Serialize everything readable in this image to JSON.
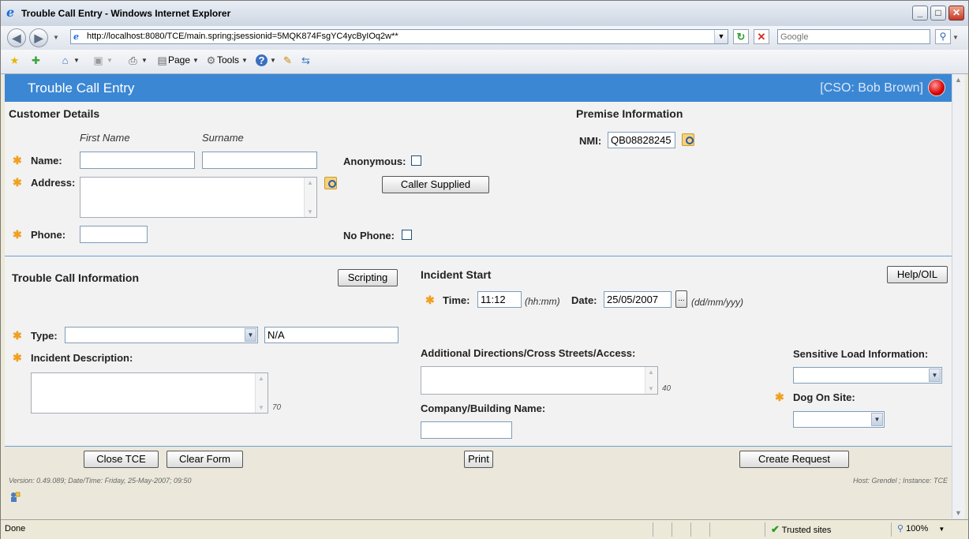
{
  "window": {
    "title": "Trouble Call Entry - Windows Internet Explorer",
    "minimize_glyph": "_",
    "maximize_glyph": "□",
    "close_glyph": "✕"
  },
  "browser": {
    "url": "http://localhost:8080/TCE/main.spring;jsessionid=5MQK874FsgYC4ycByIOq2w**",
    "search_placeholder": "Google",
    "commands": {
      "page": "Page",
      "tools": "Tools"
    },
    "status": "Done",
    "zone": "Trusted sites",
    "zoom": "100%"
  },
  "app": {
    "title": "Trouble Call Entry",
    "user": "[CSO: Bob Brown]"
  },
  "customer": {
    "heading": "Customer Details",
    "first_name_hint": "First Name",
    "surname_hint": "Surname",
    "name_label": "Name:",
    "address_label": "Address:",
    "phone_label": "Phone:",
    "anonymous_label": "Anonymous:",
    "no_phone_label": "No Phone:",
    "caller_supplied_button": "Caller Supplied",
    "first_name": "",
    "surname": "",
    "address": "",
    "phone": ""
  },
  "premise": {
    "heading": "Premise Information",
    "nmi_label": "NMI:",
    "nmi_value": "QB08828245"
  },
  "trouble_call": {
    "heading": "Trouble Call Information",
    "scripting_button": "Scripting",
    "type_label": "Type:",
    "type_value": "",
    "type_code": "N/A",
    "description_label": "Incident Description:",
    "description_limit": "70"
  },
  "incident": {
    "heading": "Incident Start",
    "help_button": "Help/OIL",
    "time_label": "Time:",
    "time_value": "11:12",
    "time_format": "(hh:mm)",
    "date_label": "Date:",
    "date_value": "25/05/2007",
    "date_picker": "...",
    "date_format": "(dd/mm/yyy)",
    "directions_label": "Additional Directions/Cross Streets/Access:",
    "directions_limit": "40",
    "company_label": "Company/Building Name:",
    "company_value": ""
  },
  "sensitive": {
    "load_label": "Sensitive Load Information:",
    "load_value": "",
    "dog_label": "Dog On Site:",
    "dog_value": ""
  },
  "actions": {
    "close": "Close TCE",
    "clear": "Clear Form",
    "print": "Print",
    "create": "Create Request"
  },
  "footer": {
    "version": "Version: 0.49.089; Date/Time: Friday, 25-May-2007; 09:50",
    "host": "Host: Grendel ; Instance: TCE"
  },
  "required_marker": "✱"
}
